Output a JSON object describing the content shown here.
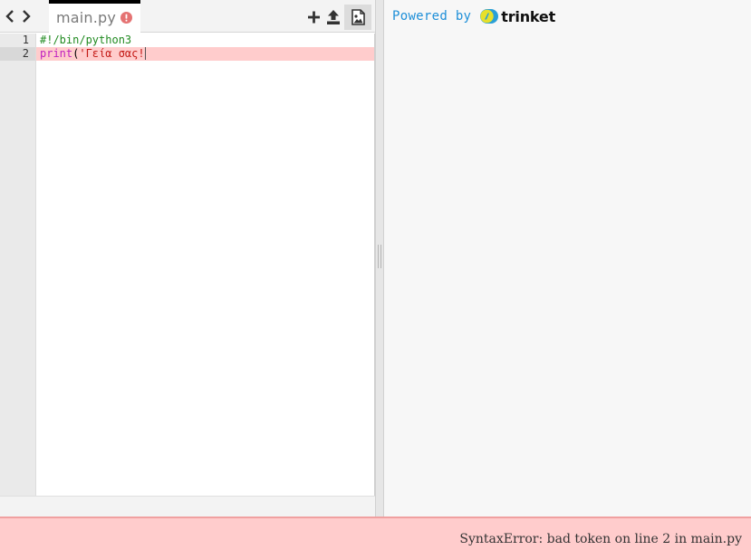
{
  "editor": {
    "tab": {
      "filename": "main.py",
      "has_error": true
    },
    "toolbar": {
      "nav_prev_icon": "chevron-left-icon",
      "nav_next_icon": "chevron-right-icon",
      "add_file_icon": "plus-icon",
      "upload_icon": "upload-icon",
      "image_icon": "image-file-icon"
    },
    "lines": [
      {
        "number": "1",
        "tokens": {
          "comment": "#!/bin/python3"
        }
      },
      {
        "number": "2",
        "tokens": {
          "builtin": "print",
          "punct": "(",
          "string": "'Γεία σας!"
        }
      }
    ],
    "active_line": 2
  },
  "output": {
    "powered_by": "Powered by",
    "brand": "trinket"
  },
  "status": {
    "error_message": "SyntaxError: bad token on line 2 in main.py"
  },
  "colors": {
    "error_highlight": "#ffcccc",
    "link_blue": "#1e8fd8",
    "tab_border": "#000000",
    "error_badge": "#e57373"
  }
}
